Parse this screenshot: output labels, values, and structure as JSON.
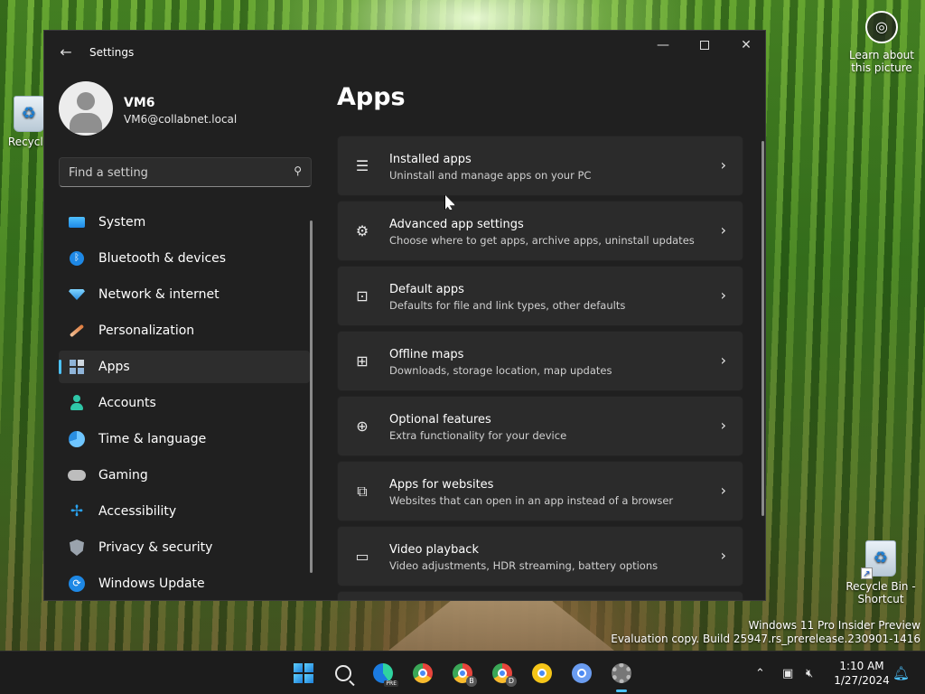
{
  "desktop": {
    "learn_label": "Learn about this picture",
    "recycle_left_label": "Recycle",
    "recycle_shortcut_label": "Recycle Bin - Shortcut",
    "watermark_line1": "Windows 11 Pro Insider Preview",
    "watermark_line2": "Evaluation copy. Build 25947.rs_prerelease.230901-1416"
  },
  "window": {
    "title": "Settings",
    "back_icon": "back-arrow-icon",
    "minimize_icon": "minimize-icon",
    "maximize_icon": "maximize-icon",
    "close_icon": "close-icon"
  },
  "profile": {
    "name": "VM6",
    "email": "VM6@collabnet.local"
  },
  "search": {
    "placeholder": "Find a setting",
    "value": ""
  },
  "nav": {
    "items": [
      {
        "label": "System",
        "icon": "system-icon"
      },
      {
        "label": "Bluetooth & devices",
        "icon": "bluetooth-icon"
      },
      {
        "label": "Network & internet",
        "icon": "network-icon"
      },
      {
        "label": "Personalization",
        "icon": "brush-icon"
      },
      {
        "label": "Apps",
        "icon": "apps-icon",
        "active": true
      },
      {
        "label": "Accounts",
        "icon": "accounts-icon"
      },
      {
        "label": "Time & language",
        "icon": "time-language-icon"
      },
      {
        "label": "Gaming",
        "icon": "gaming-icon"
      },
      {
        "label": "Accessibility",
        "icon": "accessibility-icon"
      },
      {
        "label": "Privacy & security",
        "icon": "shield-icon"
      },
      {
        "label": "Windows Update",
        "icon": "update-icon"
      }
    ]
  },
  "main": {
    "title": "Apps",
    "cards": [
      {
        "title": "Installed apps",
        "subtitle": "Uninstall and manage apps on your PC",
        "icon": "list-icon"
      },
      {
        "title": "Advanced app settings",
        "subtitle": "Choose where to get apps, archive apps, uninstall updates",
        "icon": "app-settings-icon"
      },
      {
        "title": "Default apps",
        "subtitle": "Defaults for file and link types, other defaults",
        "icon": "default-apps-icon"
      },
      {
        "title": "Offline maps",
        "subtitle": "Downloads, storage location, map updates",
        "icon": "map-icon"
      },
      {
        "title": "Optional features",
        "subtitle": "Extra functionality for your device",
        "icon": "optional-features-icon"
      },
      {
        "title": "Apps for websites",
        "subtitle": "Websites that can open in an app instead of a browser",
        "icon": "apps-for-websites-icon"
      },
      {
        "title": "Video playback",
        "subtitle": "Video adjustments, HDR streaming, battery options",
        "icon": "video-icon"
      }
    ]
  },
  "taskbar": {
    "apps": [
      "start-icon",
      "search-icon",
      "edge-preview-icon",
      "chrome-icon",
      "chrome-profile-b-icon",
      "chrome-profile-d-icon",
      "chrome-yellow-icon",
      "chrome-blue-icon",
      "settings-gear-icon"
    ],
    "edge_badge": "PRE",
    "chrome_b_badge": "B",
    "chrome_d_badge": "D",
    "time": "1:10 AM",
    "date": "1/27/2024",
    "accent_color": "#4cc2ff"
  }
}
